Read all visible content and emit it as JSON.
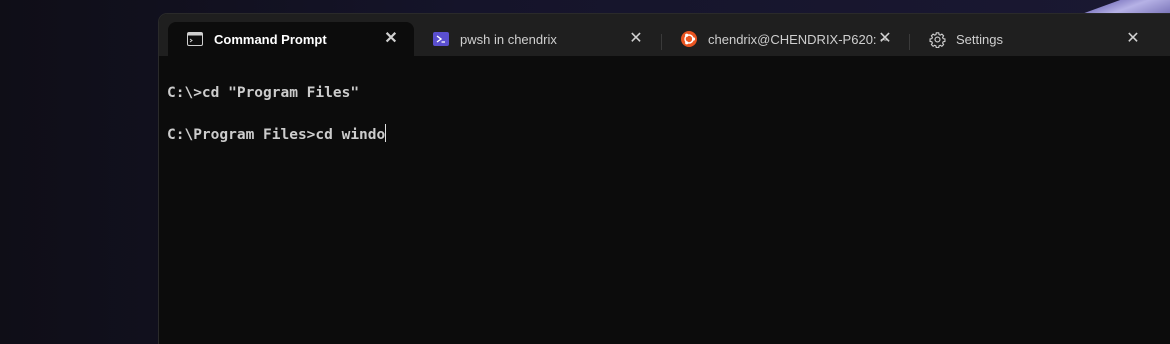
{
  "tabs": [
    {
      "label": "Command Prompt",
      "icon": "cmd-icon",
      "active": true
    },
    {
      "label": "pwsh in chendrix",
      "icon": "powershell-icon",
      "active": false
    },
    {
      "label": "chendrix@CHENDRIX-P620: ~",
      "icon": "ubuntu-icon",
      "active": false
    },
    {
      "label": "Settings",
      "icon": "gear-icon",
      "active": false
    }
  ],
  "close_glyph": "✕",
  "console": {
    "line1": "C:\\>cd \"Program Files\"",
    "line2": "C:\\Program Files>cd windo"
  },
  "colors": {
    "background": "#0c0c0c",
    "tabbar": "#1f1f1f",
    "text": "#cccccc",
    "powershell_icon": "#5a4fcf",
    "ubuntu_icon": "#e95420"
  }
}
